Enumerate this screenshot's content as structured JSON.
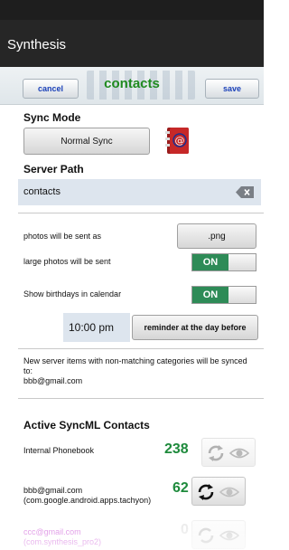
{
  "app": {
    "title": "Synthesis"
  },
  "header": {
    "cancel_label": "cancel",
    "form_title": "contacts",
    "save_label": "save"
  },
  "sync_mode": {
    "label": "Sync Mode",
    "value": "Normal Sync",
    "icon": "address-book-icon"
  },
  "server_path": {
    "label": "Server Path",
    "value": "contacts",
    "clear_icon": "clear-text-icon"
  },
  "options": {
    "photos_format_label": "photos will be sent as",
    "photos_format_value": ".png",
    "large_photos_label": "large photos will be sent",
    "large_photos_state": "ON",
    "birthdays_label": "Show birthdays in calendar",
    "birthdays_state": "ON",
    "reminder_time": "10:00 pm",
    "reminder_label": "reminder at the day before"
  },
  "info": {
    "line1": "New server items with non-matching categories will be synced to:",
    "line2": "bbb@gmail.com"
  },
  "contacts": {
    "title": "Active SyncML Contacts",
    "accounts": [
      {
        "name": "Internal Phonebook",
        "count": "238"
      },
      {
        "name": "bbb@gmail.com (com.google.android.apps.tachyon)",
        "count": "62"
      },
      {
        "name": "ccc@gmail.com (com.synthesis_pro2)",
        "count": "0"
      }
    ]
  },
  "colors": {
    "appbar": "#262626",
    "accent_blue": "#1a40b8",
    "title_green": "#1f8a1f",
    "toggle_on": "#2e8b57",
    "count_green": "#1e8a3c",
    "field_bg": "#dde5ee",
    "disabled_pink": "#d87ee0"
  }
}
